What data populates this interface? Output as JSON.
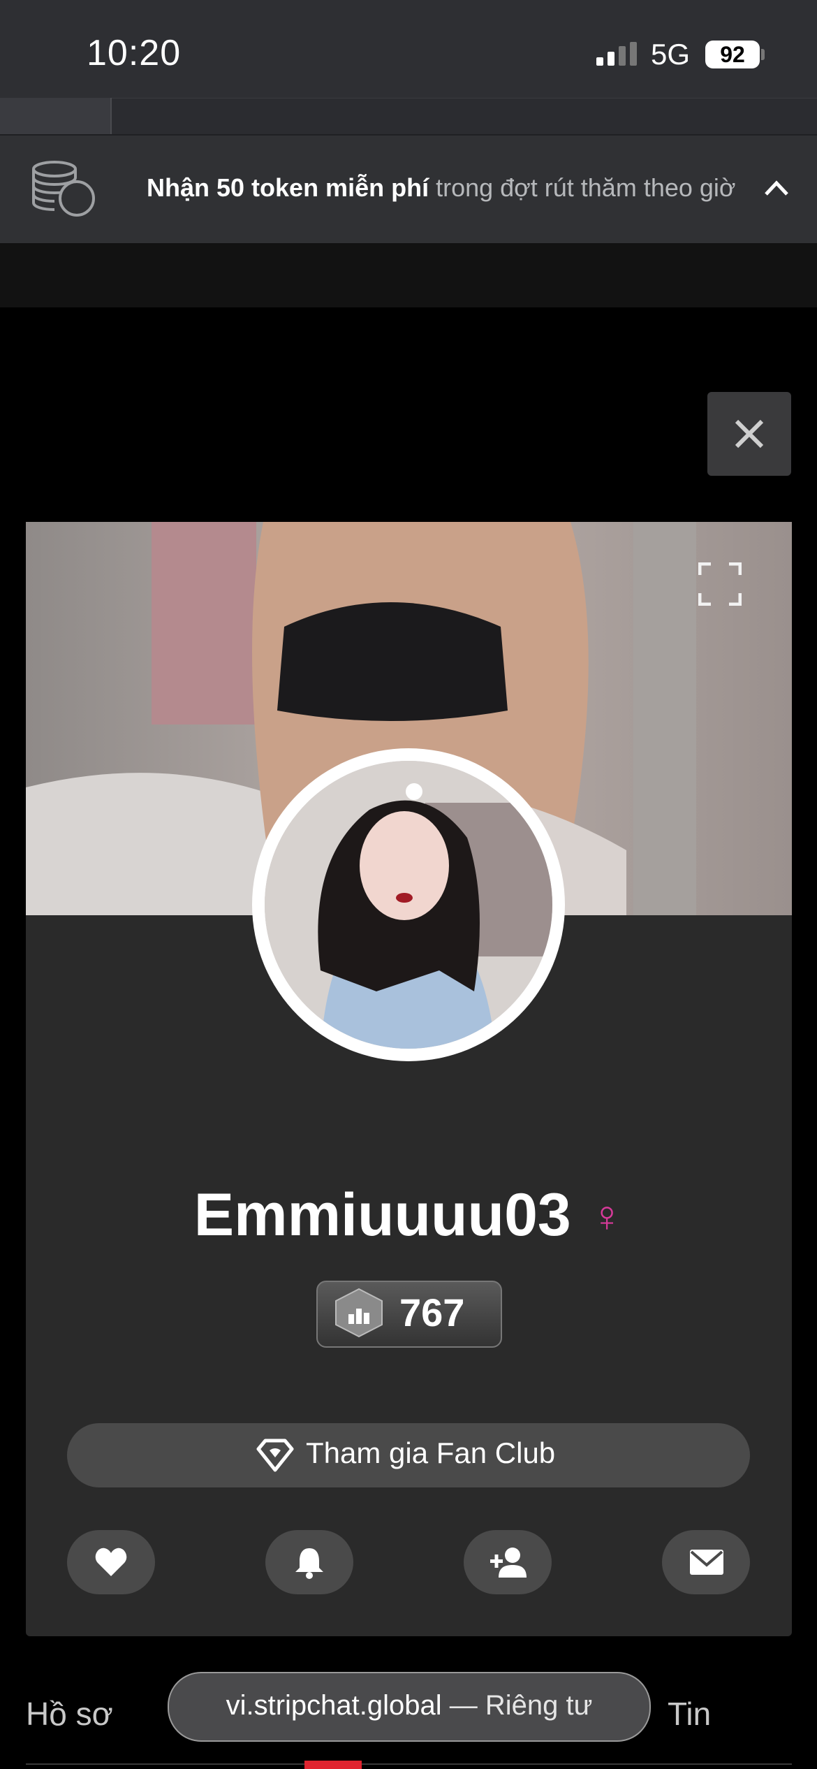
{
  "status_bar": {
    "time": "10:20",
    "network": "5G",
    "battery": "92"
  },
  "promo": {
    "highlight": "Nhận 50 token miễn phí",
    "rest": " trong đợt rút thăm theo giờ"
  },
  "profile": {
    "username": "Emmiuuuu03",
    "gender_symbol": "♀",
    "level": "767",
    "fan_club_label": "Tham gia Fan Club"
  },
  "tabs": {
    "profile": "Hồ sơ",
    "news": "Tin"
  },
  "url_bar": {
    "domain": "vi.stripchat.global",
    "suffix": " — Riêng tư"
  },
  "colors": {
    "accent_red": "#e0242f",
    "gender_pink": "#d83a9a"
  }
}
